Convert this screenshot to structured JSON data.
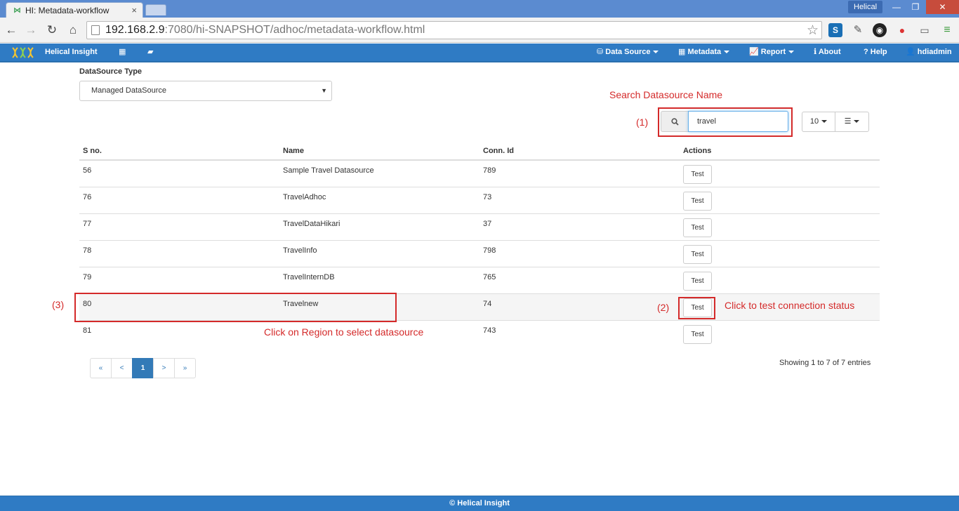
{
  "browser": {
    "tab_title": "HI: Metadata-workflow",
    "tab_favicon": "⋈",
    "tab_close": "×",
    "profile_label": "Helical",
    "url_host": "192.168.2.9",
    "url_path": ":7080/hi-SNAPSHOT/adhoc/metadata-workflow.html",
    "nav": {
      "back": "←",
      "forward": "→",
      "reload": "↻",
      "home": "⌂",
      "star": "☆"
    },
    "window": {
      "minimize": "—",
      "maximize": "❐",
      "close": "✕"
    }
  },
  "navbar": {
    "brand": "Helical Insight",
    "items": [
      {
        "label": "Data Source",
        "icon": "⛁",
        "dropdown": true
      },
      {
        "label": "Metadata",
        "icon": "▦",
        "dropdown": true
      },
      {
        "label": "Report",
        "icon": "📈",
        "dropdown": true
      },
      {
        "label": "About",
        "icon": "ℹ",
        "dropdown": false
      },
      {
        "label": "Help",
        "icon": "?",
        "dropdown": false
      },
      {
        "label": "hdiadmin",
        "icon": "👤",
        "dropdown": false
      }
    ],
    "grid_icon": "▦",
    "folder_icon": "▰"
  },
  "form": {
    "datasource_type_label": "DataSource Type",
    "datasource_type_value": "Managed DataSource",
    "select_arrow": "▼"
  },
  "search": {
    "icon": "🔍",
    "value": "travel",
    "page_size": "10",
    "columns_icon": "☰"
  },
  "table": {
    "columns": [
      "S no.",
      "Name",
      "Conn. Id",
      "Actions"
    ],
    "rows": [
      {
        "sno": "56",
        "name": "Sample Travel Datasource",
        "conn": "789",
        "action": "Test"
      },
      {
        "sno": "76",
        "name": "TravelAdhoc",
        "conn": "73",
        "action": "Test"
      },
      {
        "sno": "77",
        "name": "TravelDataHikari",
        "conn": "37",
        "action": "Test"
      },
      {
        "sno": "78",
        "name": "TravelInfo",
        "conn": "798",
        "action": "Test"
      },
      {
        "sno": "79",
        "name": "TravelInternDB",
        "conn": "765",
        "action": "Test"
      },
      {
        "sno": "80",
        "name": "Travelnew",
        "conn": "74",
        "action": "Test"
      },
      {
        "sno": "81",
        "name": "",
        "conn": "743",
        "action": "Test"
      }
    ]
  },
  "pagination": {
    "first": "«",
    "prev": "<",
    "current": "1",
    "next": ">",
    "last": "»",
    "summary": "Showing 1 to 7 of 7 entries"
  },
  "annotations": {
    "search_title": "Search Datasource Name",
    "step1": "(1)",
    "step2": "(2)",
    "step3": "(3)",
    "test_hint": "Click to test connection status",
    "region_hint": "Click on Region to select datasource",
    "color": "#d42a2a"
  },
  "footer": {
    "text": "© Helical Insight"
  },
  "colors": {
    "brand_blue": "#2f7bc4",
    "tabstrip_blue": "#5b8bd0",
    "active_page": "#337ab7"
  }
}
